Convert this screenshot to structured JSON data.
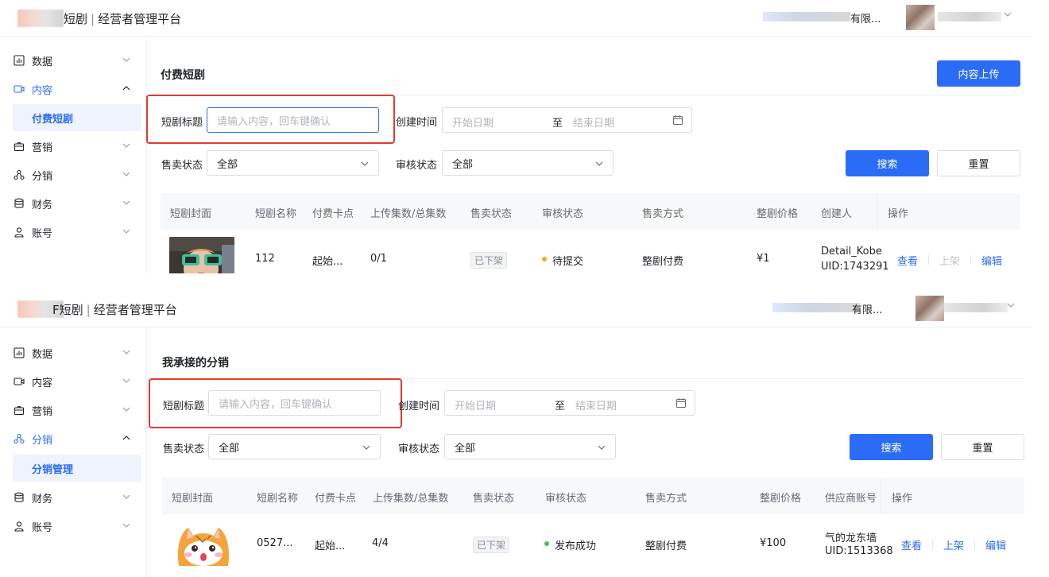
{
  "colors": {
    "accent": "#2b6cf6",
    "highlight": "#e23b2e",
    "dot_pending": "#f5a524",
    "dot_success": "#3cc36b"
  },
  "panels": [
    {
      "brand": "短剧",
      "platform": "经营者管理平台",
      "company": "有限...",
      "nav": [
        {
          "label": "数据",
          "icon": "bar-chart-icon",
          "expanded": false
        },
        {
          "label": "内容",
          "icon": "video-icon",
          "expanded": true,
          "active": true
        },
        {
          "label": "营销",
          "icon": "gift-icon",
          "expanded": false
        },
        {
          "label": "分销",
          "icon": "share-nodes-icon",
          "expanded": false
        },
        {
          "label": "财务",
          "icon": "database-icon",
          "expanded": false
        },
        {
          "label": "账号",
          "icon": "user-icon",
          "expanded": false
        }
      ],
      "sub_item": "付费短剧",
      "page_title": "付费短剧",
      "upload_label": "内容上传",
      "filters": {
        "title_label": "短剧标题",
        "title_placeholder": "请输入内容，回车键确认",
        "time_label": "创建时间",
        "start_placeholder": "开始日期",
        "to": "至",
        "end_placeholder": "结束日期",
        "sale_label": "售卖状态",
        "sale_value": "全部",
        "audit_label": "审核状态",
        "audit_value": "全部",
        "search": "搜索",
        "reset": "重置"
      },
      "columns": [
        "短剧封面",
        "短剧名称",
        "付费卡点",
        "上传集数/总集数",
        "售卖状态",
        "审核状态",
        "售卖方式",
        "整剧价格",
        "创建人",
        "操作"
      ],
      "row": {
        "name": "112",
        "pay_point": "起始...",
        "episodes": "0/1",
        "sale_status": "已下架",
        "audit_status": "待提交",
        "sale_mode": "整剧付费",
        "price": "¥1",
        "creator_line1": "Detail_Kobe",
        "creator_line2": "UID:1743291",
        "actions": [
          "查看",
          "上架",
          "编辑"
        ]
      }
    },
    {
      "brand": "F短剧",
      "platform": "经营者管理平台",
      "company": "有限...",
      "nav": [
        {
          "label": "数据",
          "icon": "bar-chart-icon",
          "expanded": false
        },
        {
          "label": "内容",
          "icon": "video-icon",
          "expanded": false
        },
        {
          "label": "营销",
          "icon": "gift-icon",
          "expanded": false
        },
        {
          "label": "分销",
          "icon": "share-nodes-icon",
          "expanded": true,
          "active": true
        },
        {
          "label": "财务",
          "icon": "database-icon",
          "expanded": false
        },
        {
          "label": "账号",
          "icon": "user-icon",
          "expanded": false
        }
      ],
      "sub_item": "分销管理",
      "page_title": "我承接的分销",
      "filters": {
        "title_label": "短剧标题",
        "title_placeholder": "请输入内容，回车键确认",
        "time_label": "创建时间",
        "start_placeholder": "开始日期",
        "to": "至",
        "end_placeholder": "结束日期",
        "sale_label": "售卖状态",
        "sale_value": "全部",
        "audit_label": "审核状态",
        "audit_value": "全部",
        "search": "搜索",
        "reset": "重置"
      },
      "columns": [
        "短剧封面",
        "短剧名称",
        "付费卡点",
        "上传集数/总集数",
        "售卖状态",
        "审核状态",
        "售卖方式",
        "整剧价格",
        "供应商账号",
        "操作"
      ],
      "row": {
        "name": "0527...",
        "pay_point": "起始...",
        "episodes": "4/4",
        "sale_status": "已下架",
        "audit_status": "发布成功",
        "sale_mode": "整剧付费",
        "price": "¥100",
        "creator_line1": "气的龙东墙",
        "creator_line2": "UID:1513368",
        "actions": [
          "查看",
          "上架",
          "编辑"
        ]
      }
    }
  ]
}
